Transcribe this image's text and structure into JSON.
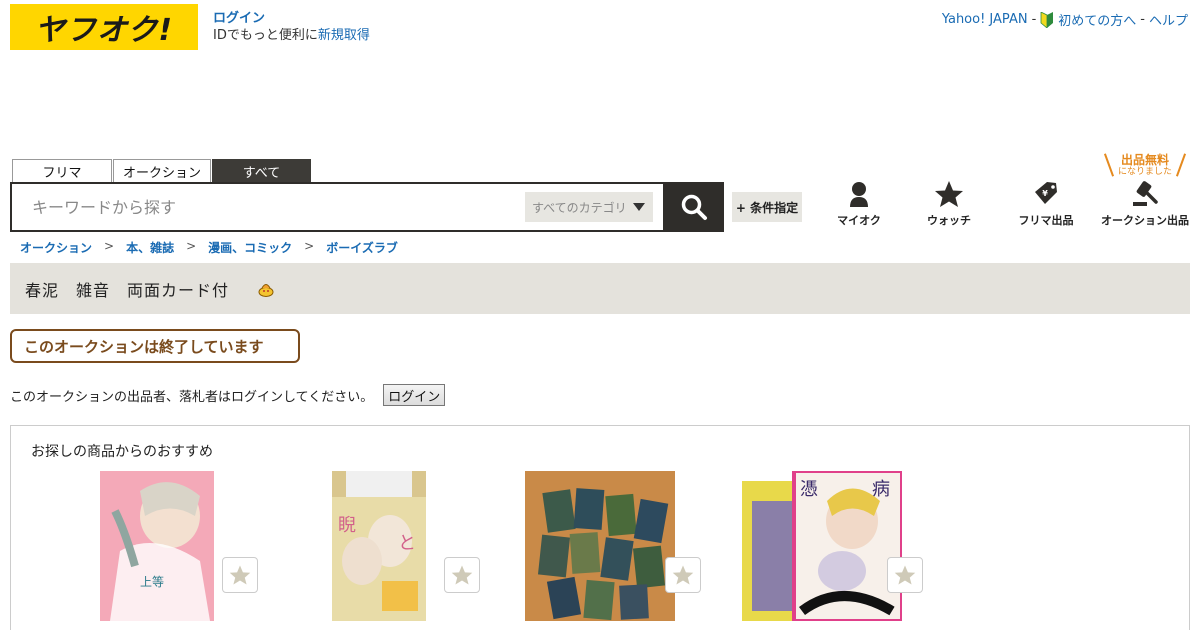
{
  "header": {
    "logo_text": "ヤフオク!",
    "login_link": "ログイン",
    "login_sub": "IDでもっと便利に",
    "register_link": "新規取得",
    "links": {
      "yahoo": "Yahoo! JAPAN",
      "sep": "-",
      "beginner": "初めての方へ",
      "help": "ヘルプ"
    }
  },
  "tabs": [
    {
      "label": "フリマ",
      "active": false
    },
    {
      "label": "オークション",
      "active": false
    },
    {
      "label": "すべて",
      "active": true
    }
  ],
  "search": {
    "placeholder": "キーワードから探す",
    "category": "すべてのカテゴリ",
    "condition_button": "+ 条件指定"
  },
  "nav": {
    "myauc": "マイオク",
    "watch": "ウォッチ",
    "flea_sell": "フリマ出品",
    "auction_sell": "オークション出品",
    "free_badge_big": "出品無料",
    "free_badge_small": "になりました"
  },
  "breadcrumb": [
    "オークション",
    "本、雑誌",
    "漫画、コミック",
    "ボーイズラブ"
  ],
  "breadcrumb_sep": ">",
  "item": {
    "title": "春泥　雑音　両面カード付"
  },
  "ended_label": "このオークションは終了しています",
  "notice": {
    "text": "このオークションの出品者、落札者はログインしてください。",
    "button": "ログイン"
  },
  "recommendations": {
    "title": "お探しの商品からのおすすめ"
  },
  "colors": {
    "brand_yellow": "#ffd600",
    "link_blue": "#1a6bb3",
    "dark": "#2f2d2a",
    "ended_brown": "#7a4b1d",
    "free_orange": "#e58a1f"
  }
}
